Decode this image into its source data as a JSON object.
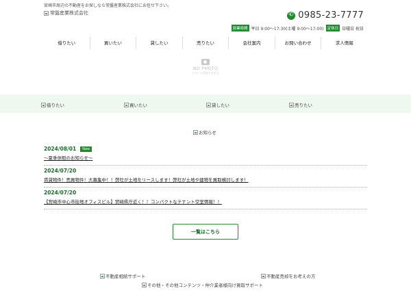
{
  "header": {
    "tagline": "宮崎市周辺の不動産をお探しなら常盤産業株式会社にお任せ下さい。",
    "logo_alt": "常盤産業株式会社",
    "phone": "0985-23-7777",
    "hours_label": "営業時間",
    "hours_text": "平日 9:00～17:30(土曜 9:00～17:00)",
    "holiday_label": "定休日",
    "holiday_text": "日曜日 祝日"
  },
  "nav": [
    "借りたい",
    "買いたい",
    "貸したい",
    "売りたい",
    "会社案内",
    "お問い合わせ",
    "求人情報"
  ],
  "nophoto": {
    "title": "NO PHOTO",
    "subtitle": "イメージがありません"
  },
  "band": [
    "借りたい",
    "買いたい",
    "貸したい",
    "売りたい"
  ],
  "news": {
    "heading_alt": "お知らせ",
    "new_label": "New",
    "items": [
      {
        "date": "2024/08/01",
        "title": "～夏季休暇のお知らせ～"
      },
      {
        "date": "2024/07/20",
        "title": "賃貸物件！売買物件！大募集中！！弊社が土地をリースします！弊社が土地や建物を買取検討します！"
      },
      {
        "date": "2024/07/20",
        "title": "【宮崎市中心市街地オフィスビル】宮崎県庁近く！！コンパクトなテナント空室情報！！"
      }
    ],
    "more_label": "一覧はこちら"
  },
  "banners": [
    "不動産相続サポート",
    "不動産売却をお考えの方",
    "その他・その他コンテンツ・仲介業者様向け買取サポート"
  ]
}
